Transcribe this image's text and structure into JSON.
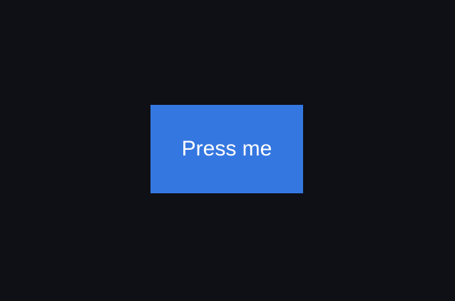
{
  "colors": {
    "background": "#0e1015",
    "button": "#3577e0",
    "button_text": "#ffffff"
  },
  "main": {
    "button_label": "Press me"
  }
}
